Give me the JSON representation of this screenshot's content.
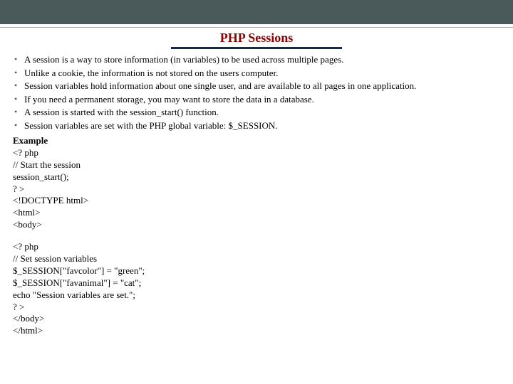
{
  "title": "PHP  Sessions",
  "titleUnderlineWidth": "240px",
  "bullets": [
    "A session is a way to store information (in variables) to be used across multiple pages.",
    "Unlike a cookie, the information is not stored on the users computer.",
    "Session variables hold information about one single user, and are available to all pages in one application.",
    "If you need a permanent storage, you may want to store the data in a database.",
    "A session is started with the session_start() function.",
    "Session variables are set with the PHP global variable: $_SESSION."
  ],
  "exampleLabel": "Example",
  "code1": "<? php\n// Start the session\nsession_start();\n? >\n<!DOCTYPE html>\n<html>\n<body>",
  "code2": "<? php\n// Set session variables\n$_SESSION[\"favcolor\"] = \"green\";\n$_SESSION[\"favanimal\"] = \"cat\";\necho \"Session variables are set.\";\n? >\n</body>\n</html>"
}
